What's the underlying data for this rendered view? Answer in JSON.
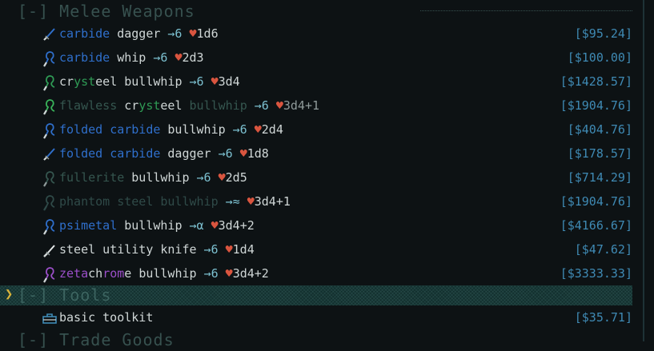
{
  "categories": [
    {
      "label": "[-] Melee Weapons",
      "cursor": ""
    },
    {
      "label": "[-] Tools",
      "cursor": "❯"
    },
    {
      "label": "[-] Trade Goods",
      "cursor": ""
    }
  ],
  "items": [
    {
      "parts": [
        {
          "t": "carbide",
          "c": "c-blue"
        },
        {
          "t": "dagger",
          "c": "c-light"
        }
      ],
      "arrow": "→6",
      "heart": "♥",
      "dmg": "1d6",
      "price": "[$95.24]",
      "icon": "dagger-icon"
    },
    {
      "parts": [
        {
          "t": "carbide",
          "c": "c-blue"
        },
        {
          "t": "whip",
          "c": "c-light"
        }
      ],
      "arrow": "→6",
      "heart": "♥",
      "dmg": "2d3",
      "price": "[$100.00]",
      "icon": "whip-icon"
    },
    {
      "parts": [
        {
          "t": "crysteel",
          "c": "c-light"
        },
        {
          "t": "bullwhip",
          "c": "c-light"
        }
      ],
      "arrow": "→6",
      "heart": "♥",
      "dmg": "3d4",
      "price": "[$1428.57]",
      "icon": "whip-icon"
    },
    {
      "parts": [
        {
          "t": "flawless",
          "c": "c-dim"
        },
        {
          "t": "crysteel",
          "c": "c-light"
        },
        {
          "t": "bullwhip",
          "c": "c-dim"
        }
      ],
      "arrow": "→6",
      "heart": "♥",
      "dmg": "3d4+1",
      "price": "[$1904.76]",
      "icon": "whip-icon"
    },
    {
      "parts": [
        {
          "t": "folded",
          "c": "c-blue"
        },
        {
          "t": "carbide",
          "c": "c-blue"
        },
        {
          "t": "bullwhip",
          "c": "c-light"
        }
      ],
      "arrow": "→6",
      "heart": "♥",
      "dmg": "2d4",
      "price": "[$404.76]",
      "icon": "whip-icon"
    },
    {
      "parts": [
        {
          "t": "folded",
          "c": "c-blue"
        },
        {
          "t": "carbide",
          "c": "c-blue"
        },
        {
          "t": "dagger",
          "c": "c-light"
        }
      ],
      "arrow": "→6",
      "heart": "♥",
      "dmg": "1d8",
      "price": "[$178.57]",
      "icon": "dagger-icon"
    },
    {
      "parts": [
        {
          "t": "fullerite",
          "c": "c-dim"
        },
        {
          "t": "bullwhip",
          "c": "c-light"
        }
      ],
      "arrow": "→6",
      "heart": "♥",
      "dmg": "2d5",
      "price": "[$714.29]",
      "icon": "whip-icon"
    },
    {
      "parts": [
        {
          "t": "phantom",
          "c": "c-dimg"
        },
        {
          "t": "steel",
          "c": "c-dimg"
        },
        {
          "t": "bullwhip",
          "c": "c-dimg"
        }
      ],
      "arrow": "→≈",
      "heart": "♥",
      "dmg": "3d4+1",
      "price": "[$1904.76]",
      "icon": "whip-icon"
    },
    {
      "parts": [
        {
          "t": "psimetal",
          "c": "c-blue"
        },
        {
          "t": "bullwhip",
          "c": "c-light"
        }
      ],
      "arrow": "→α",
      "heart": "♥",
      "dmg": "3d4+2",
      "price": "[$4166.67]",
      "icon": "whip-icon"
    },
    {
      "parts": [
        {
          "t": "steel",
          "c": "c-light"
        },
        {
          "t": "utility",
          "c": "c-light"
        },
        {
          "t": "knife",
          "c": "c-light"
        }
      ],
      "arrow": "→6",
      "heart": "♥",
      "dmg": "1d4",
      "price": "[$47.62]",
      "icon": "knife-icon"
    },
    {
      "parts": [
        {
          "t": "zetachrome",
          "c": "c-purple"
        },
        {
          "t": "bullwhip",
          "c": "c-light"
        }
      ],
      "arrow": "→6",
      "heart": "♥",
      "dmg": "3d4+2",
      "price": "[$3333.33]",
      "icon": "whip-icon"
    },
    {
      "parts": [
        {
          "t": "basic",
          "c": "c-light"
        },
        {
          "t": "toolkit",
          "c": "c-light"
        }
      ],
      "arrow": "",
      "heart": "",
      "dmg": "",
      "price": "[$35.71]",
      "icon": "toolkit-icon"
    }
  ],
  "colors": {
    "background": "#0d1214",
    "price": "#3f8ab4",
    "item_blue": "#2f6fcb",
    "item_green": "#2f9b55",
    "item_purple": "#9b4fc9",
    "heart": "#d9553f",
    "selection": "#13302f",
    "cursor": "#d8b33a"
  }
}
